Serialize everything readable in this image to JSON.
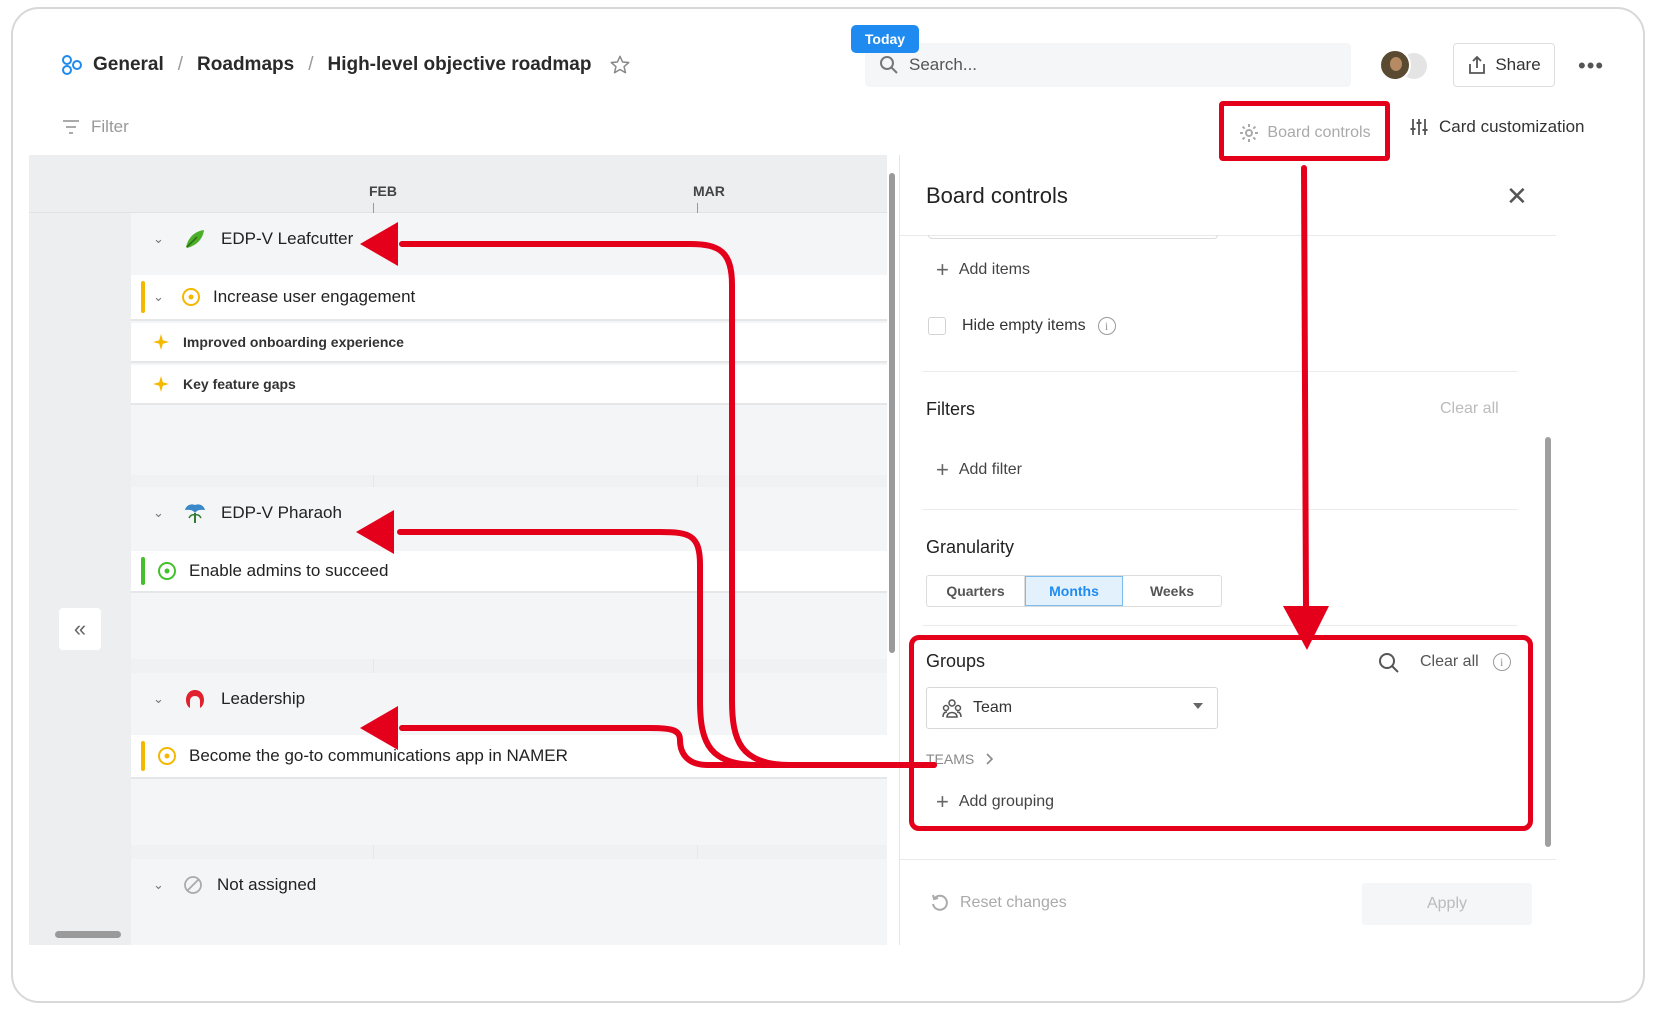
{
  "breadcrumb": {
    "items": [
      "General",
      "Roadmaps",
      "High-level objective roadmap"
    ],
    "separator": "/"
  },
  "search": {
    "placeholder": "Search..."
  },
  "header": {
    "share_label": "Share",
    "more_label": "•••"
  },
  "toolbar": {
    "filter_label": "Filter",
    "board_controls_label": "Board controls",
    "card_customization_label": "Card customization"
  },
  "timeline": {
    "months": [
      "FEB",
      "MAR"
    ],
    "today_label": "Today",
    "collapse_label": "«",
    "groups": [
      {
        "title": "EDP-V Leafcutter"
      },
      {
        "title": "EDP-V Pharaoh"
      },
      {
        "title": "Leadership"
      },
      {
        "title": "Not assigned"
      }
    ],
    "objectives": [
      {
        "title": "Increase user engagement",
        "color": "#f5b800"
      },
      {
        "title": "Enable admins to succeed",
        "color": "#43c02b"
      },
      {
        "title": "Become the go-to communications app in NAMER",
        "color": "#f5b800"
      }
    ],
    "key_results": [
      {
        "title": "Improved onboarding experience"
      },
      {
        "title": "Key feature gaps"
      }
    ]
  },
  "panel": {
    "title": "Board controls",
    "close_label": "✕",
    "add_items_label": "Add items",
    "hide_empty_label": "Hide empty items",
    "info_label": "i",
    "filters": {
      "title": "Filters",
      "clear_all_label": "Clear all",
      "add_filter_label": "Add filter"
    },
    "granularity": {
      "title": "Granularity",
      "options": [
        "Quarters",
        "Months",
        "Weeks"
      ],
      "selected": "Months"
    },
    "groups": {
      "title": "Groups",
      "clear_all_label": "Clear all",
      "selected_value": "Team",
      "sub_label": "TEAMS",
      "add_grouping_label": "Add grouping"
    },
    "reset_label": "Reset changes",
    "apply_label": "Apply"
  },
  "colors": {
    "accent": "#1f8bf0",
    "annotation_red": "#e4001b"
  }
}
